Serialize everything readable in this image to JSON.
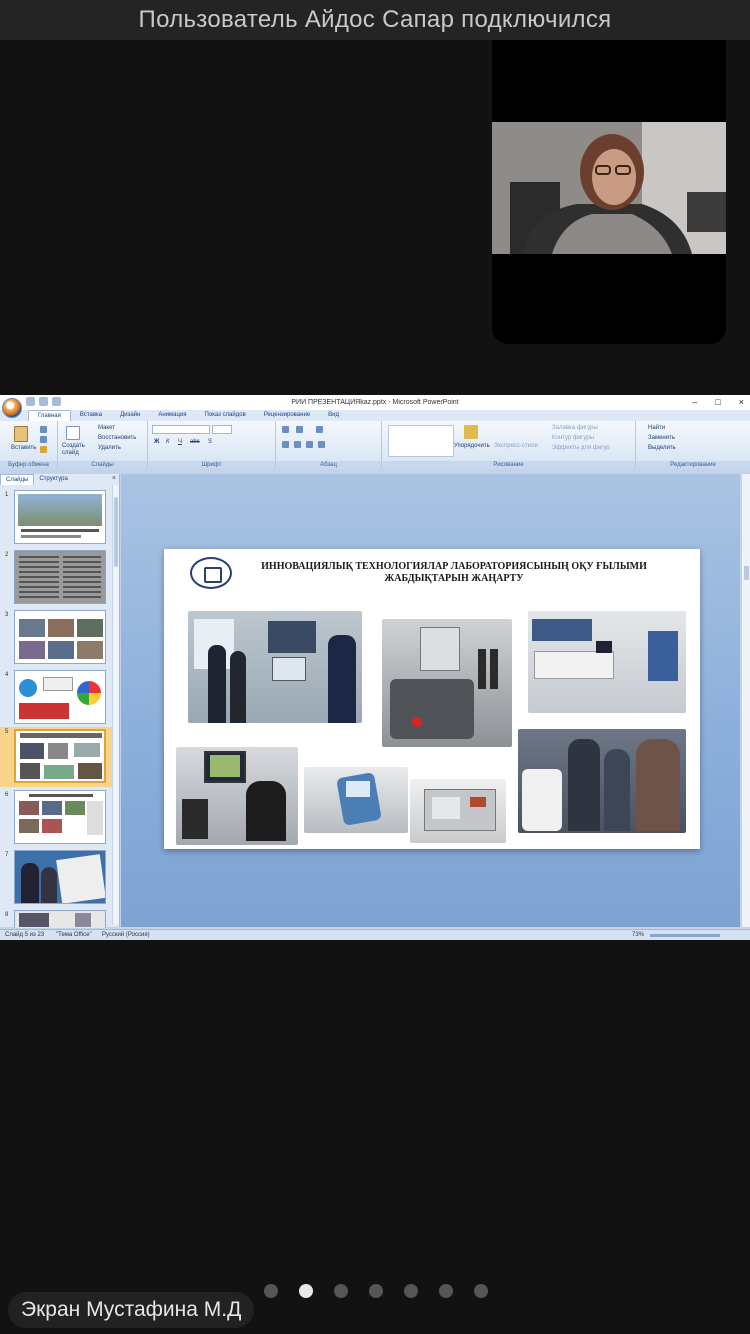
{
  "meeting": {
    "notification": "Пользователь Айдос Сапар подключился",
    "share_label": "Экран Мустафина М.Д",
    "page_dots": 7,
    "active_page_index": 1
  },
  "ppt": {
    "window_title": "РИИ ПРЕЗЕНТАЦИЯkaz.pptx - Microsoft PowerPoint",
    "window_controls": [
      "–",
      "□",
      "×"
    ],
    "tabs": [
      "Главная",
      "Вставка",
      "Дизайн",
      "Анимация",
      "Показ слайдов",
      "Рецензирование",
      "Вид"
    ],
    "active_tab": "Главная",
    "ribbon": {
      "clipboard": {
        "paste": "Вставить",
        "group": "Буфер обмена"
      },
      "slides": {
        "new_slide": "Создать слайд",
        "layout": "Макет",
        "reset": "Восстановить",
        "delete": "Удалить",
        "group": "Слайды"
      },
      "font": {
        "group": "Шрифт",
        "bold": "Ж",
        "italic": "К",
        "underline": "Ч",
        "strike": "abc",
        "shadow": "S"
      },
      "paragraph": {
        "group": "Абзац"
      },
      "drawing": {
        "arrange": "Упорядочить",
        "quick_styles": "Экспресс-стили",
        "fill": "Заливка фигуры",
        "outline": "Контур фигуры",
        "effects": "Эффекты для фигур",
        "group": "Рисование"
      },
      "editing": {
        "find": "Найти",
        "replace": "Заменить",
        "select": "Выделить",
        "group": "Редактирование"
      }
    },
    "side_panel": {
      "tabs": [
        "Слайды",
        "Структура"
      ],
      "active_tab": "Слайды",
      "close": "×",
      "slide_numbers": [
        "1",
        "2",
        "3",
        "4",
        "5",
        "6",
        "7",
        "8"
      ],
      "active_slide": "5"
    },
    "slide": {
      "title": "ИННОВАЦИЯЛЫҚ ТЕХНОЛОГИЯЛАР ЛАБОРАТОРИЯСЫНЫҢ ОҚУ ҒЫЛЫМИ ЖАБДЫҚТАРЫН ЖАҢАРТУ"
    },
    "status": {
      "slide_counter": "Слайд 5 из 23",
      "theme": "\"Тема Office\"",
      "language": "Русский (Россия)",
      "zoom": "73%"
    }
  }
}
